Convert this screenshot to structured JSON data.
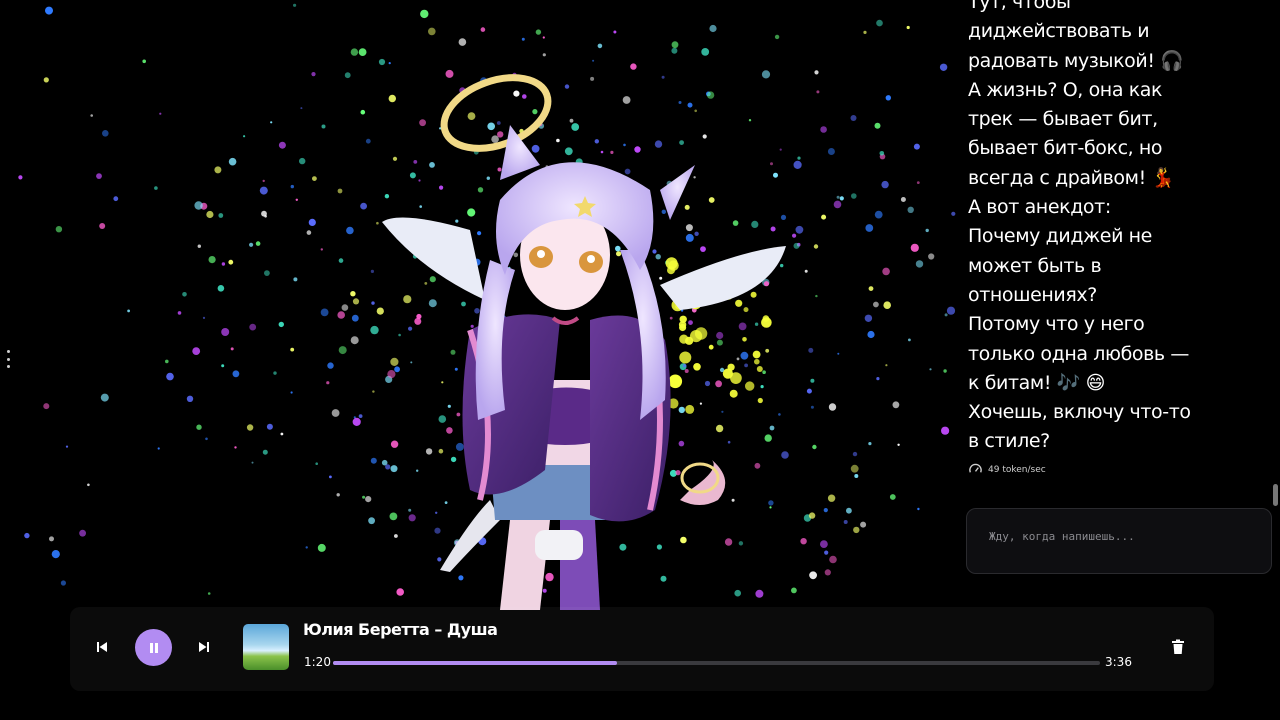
{
  "chat": {
    "message": "Тут, чтобы\nдиджействовать и\nрадовать музыкой! 🎧\nА жизнь? О, она как\nтрек — бывает бит,\nбывает бит-бокс, но\nвсегда с драйвом! 💃\nА вот анекдот:\nПочему диджей не\nможет быть в\nотношениях?\nПотому что у него\nтолько одна любовь —\nк битам! 🎶 😄\nХочешь, включу что-то\nв стиле?",
    "stats": "49 token/sec",
    "stats_icon": "speedometer-icon",
    "input_placeholder": "Жду, когда напишешь..."
  },
  "player": {
    "track_title": "Юлия Беретта – Душа",
    "current_time": "1:20",
    "total_time": "3:36",
    "progress_fraction": 0.37,
    "state": "playing",
    "accent_color": "#b28cf2",
    "icons": {
      "prev": "skip-previous-icon",
      "play": "pause-icon",
      "next": "skip-next-icon",
      "delete": "trash-icon"
    }
  },
  "background": {
    "description_color": "#000000"
  }
}
